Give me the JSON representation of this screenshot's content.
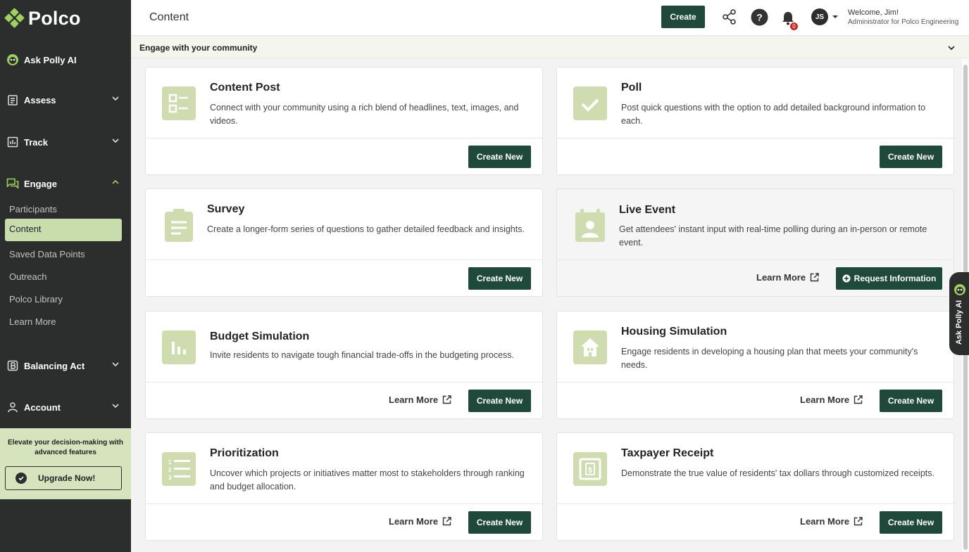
{
  "sidebar": {
    "logo": "Polco",
    "ask_polly": "Ask Polly AI",
    "assess": "Assess",
    "track": "Track",
    "engage": "Engage",
    "engage_items": [
      "Participants",
      "Content",
      "Saved Data Points",
      "Outreach",
      "Polco Library",
      "Learn More"
    ],
    "balancing_act": "Balancing Act",
    "account": "Account",
    "upgrade_text": "Elevate your decision-making with advanced features",
    "upgrade_button": "Upgrade Now!"
  },
  "header": {
    "title": "Content",
    "create_label": "Create",
    "notification_count": "0",
    "avatar_initials": "JS",
    "welcome": "Welcome, Jim!",
    "role": "Administrator for Polco Engineering"
  },
  "banner": {
    "title": "Engage with your community"
  },
  "cards": [
    {
      "title": "Content Post",
      "desc": "Connect with your community using a rich blend of headlines, text, images, and videos.",
      "create": "Create New"
    },
    {
      "title": "Poll",
      "desc": "Post quick questions with the option to add detailed background information to each.",
      "create": "Create New"
    },
    {
      "title": "Survey",
      "desc": "Create a longer-form series of questions to gather detailed feedback and insights.",
      "create": "Create New"
    },
    {
      "title": "Live Event",
      "desc": "Get attendees' instant input with real-time polling during an in-person or remote event.",
      "learn": "Learn More",
      "request": "Request Information"
    },
    {
      "title": "Budget Simulation",
      "desc": "Invite residents to navigate tough financial trade-offs in the budgeting process.",
      "learn": "Learn More",
      "create": "Create New"
    },
    {
      "title": "Housing Simulation",
      "desc": "Engage residents in developing a housing plan that meets your community's needs.",
      "learn": "Learn More",
      "create": "Create New"
    },
    {
      "title": "Prioritization",
      "desc": "Uncover which projects or initiatives matter most to stakeholders through ranking and budget allocation.",
      "learn": "Learn More",
      "create": "Create New"
    },
    {
      "title": "Taxpayer Receipt",
      "desc": "Demonstrate the true value of residents' tax dollars through customized receipts.",
      "learn": "Learn More",
      "create": "Create New"
    }
  ],
  "polly_tab": "Ask Polly AI",
  "colors": {
    "sidebar": "#2b2e2d",
    "accent": "#1f4a3b",
    "highlight": "#c9dcab",
    "icon_bg": "#cfdcb0"
  }
}
